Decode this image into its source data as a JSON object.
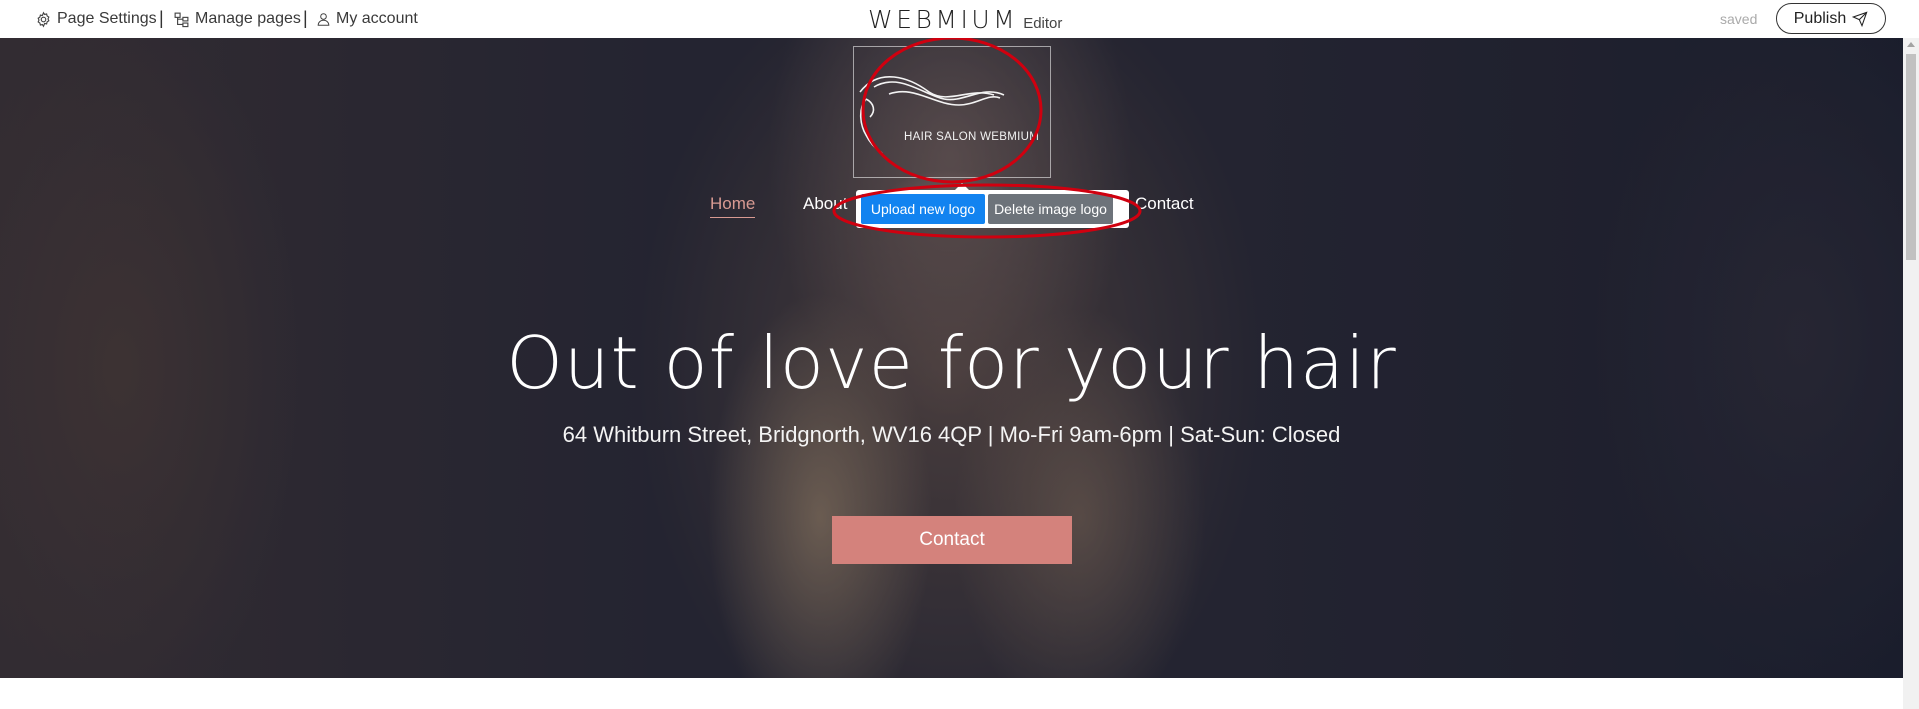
{
  "editor_bar": {
    "page_settings": "Page Settings",
    "separator": "|",
    "manage_pages": "Manage pages",
    "my_account": "My account",
    "brand": "WEBMIUM",
    "brand_suffix": "Editor",
    "status": "saved",
    "publish": "Publish"
  },
  "site": {
    "logo_text": "HAIR SALON WEBMIUM",
    "nav": [
      "Home",
      "About",
      "Contact"
    ],
    "logo_popup": {
      "upload": "Upload new logo",
      "delete": "Delete image logo"
    },
    "hero": {
      "title": "Out of love for your hair",
      "subtitle": "64 Whitburn Street, Bridgnorth, WV16 4QP | Mo-Fri 9am-6pm | Sat-Sun: Closed",
      "cta": "Contact"
    }
  },
  "colors": {
    "accent": "#d4827c",
    "nav_active": "#d89a92",
    "upload_button": "#1283f0",
    "delete_button": "#6d737a",
    "annotation": "#d0000f"
  },
  "icons": [
    "gear-icon",
    "sitemap-icon",
    "user-icon",
    "send-icon"
  ]
}
